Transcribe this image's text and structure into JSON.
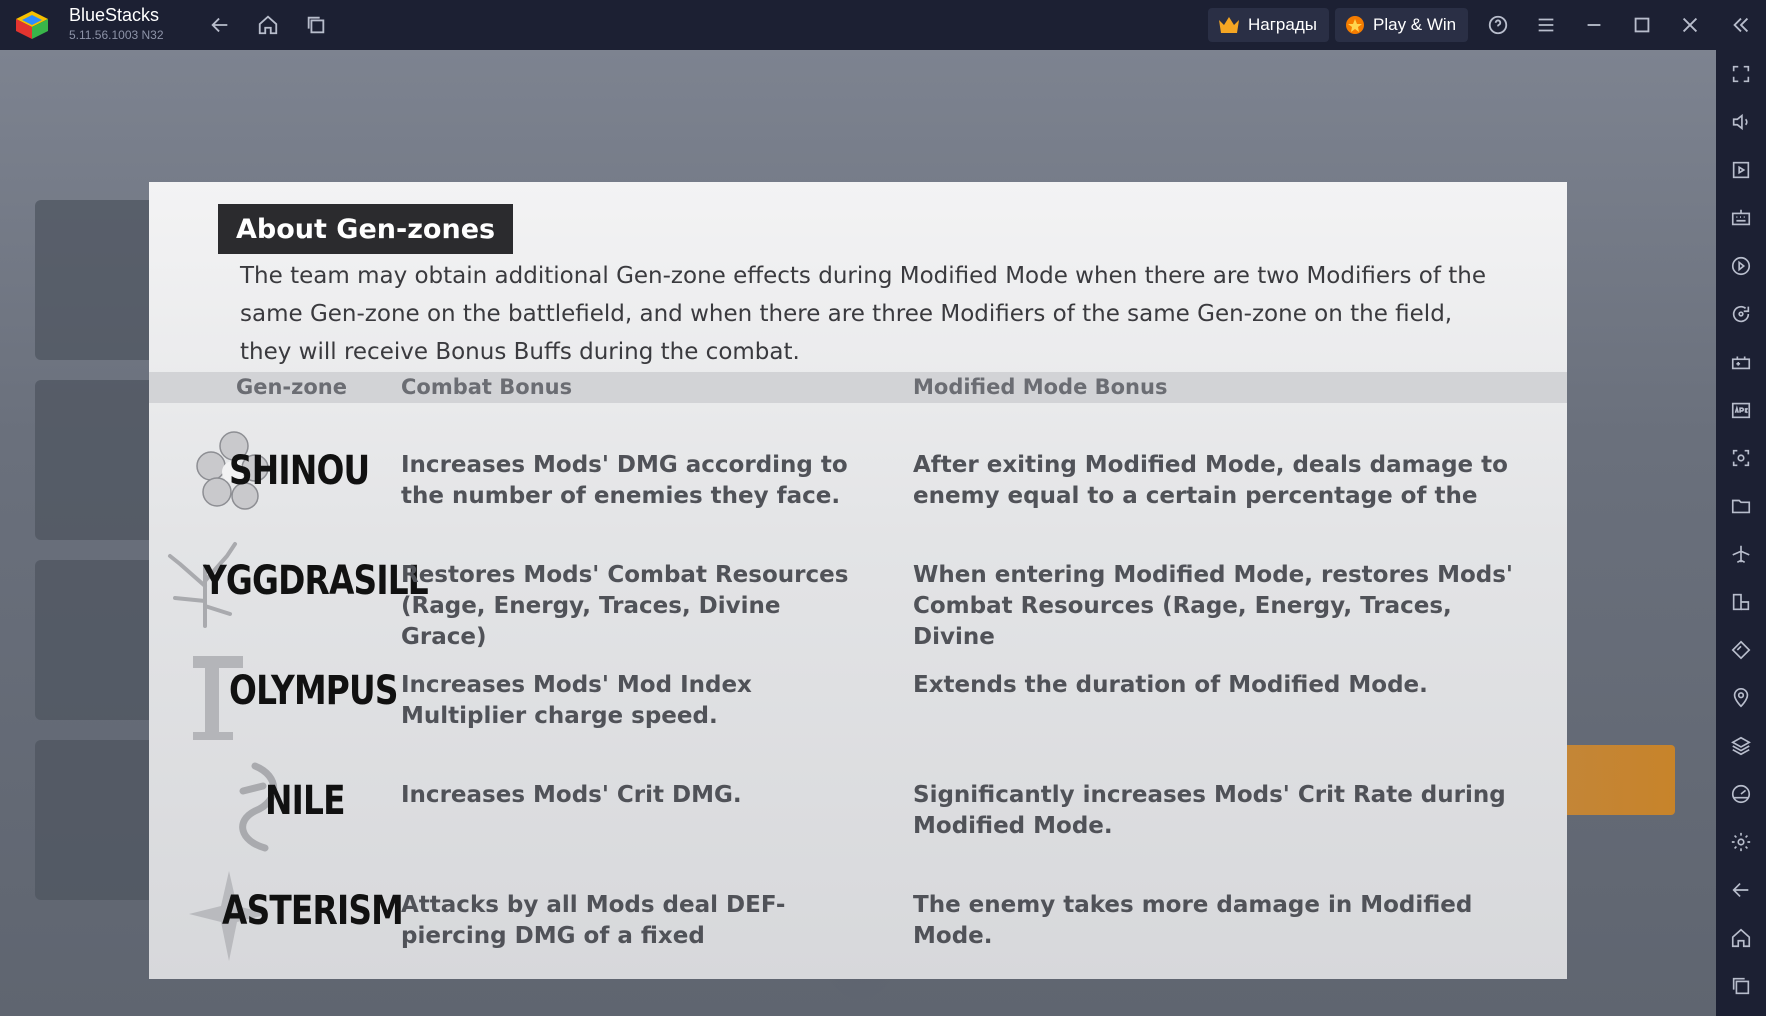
{
  "titlebar": {
    "app_name": "BlueStacks",
    "version": "5.11.56.1003  N32",
    "rewards_label": "Награды",
    "playwin_label": "Play & Win"
  },
  "panel": {
    "title": "About Gen-zones",
    "description": "The team may obtain additional Gen-zone effects during Modified Mode when there are two Modifiers of the same Gen-zone on the battlefield, and when there are three Modifiers of the same Gen-zone on the field, they will receive Bonus Buffs during the combat.",
    "headers": {
      "genzone": "Gen-zone",
      "combat": "Combat Bonus",
      "modified": "Modified Mode Bonus"
    },
    "rows": [
      {
        "zone": "SHINOU",
        "combat": "Increases Mods' DMG according to the number of enemies they face.",
        "modified": "After exiting Modified Mode, deals damage to enemy equal to a certain percentage of the"
      },
      {
        "zone": "YGGDRASILL",
        "combat": "Restores Mods' Combat Resources (Rage, Energy, Traces, Divine Grace)",
        "modified": "When entering Modified Mode, restores Mods' Combat Resources (Rage, Energy, Traces, Divine"
      },
      {
        "zone": "OLYMPUS",
        "combat": "Increases Mods' Mod Index Multiplier charge speed.",
        "modified": "Extends the duration of Modified Mode."
      },
      {
        "zone": "NILE",
        "combat": "Increases Mods' Crit DMG.",
        "modified": "Significantly increases Mods' Crit Rate during Modified Mode."
      },
      {
        "zone": "ASTERISM",
        "combat": "Attacks by all Mods deal DEF-piercing DMG of a fixed",
        "modified": "The enemy takes more damage in Modified Mode."
      }
    ]
  },
  "colors": {
    "titlebar_bg": "#1c2033",
    "panel_title_bg": "#2b2b2e",
    "accent_orange": "#d9881d"
  },
  "icons": {
    "titlebar": [
      "back-icon",
      "home-icon",
      "multi-instance-icon",
      "crown-icon",
      "playwin-icon",
      "help-icon",
      "menu-icon",
      "minimize-icon",
      "maximize-icon",
      "close-icon",
      "collapse-sidebar-icon"
    ],
    "sidebar": [
      "fullscreen-icon",
      "volume-icon",
      "media-icon",
      "keyboard-icon",
      "macro-icon",
      "rotate-icon",
      "gamepad-icon",
      "apk-icon",
      "screenshot-icon",
      "folder-icon",
      "airplane-icon",
      "resize-icon",
      "eco-icon",
      "location-icon",
      "layers-icon",
      "performance-icon",
      "settings-icon",
      "back-icon",
      "home-icon",
      "recent-apps-icon"
    ]
  }
}
